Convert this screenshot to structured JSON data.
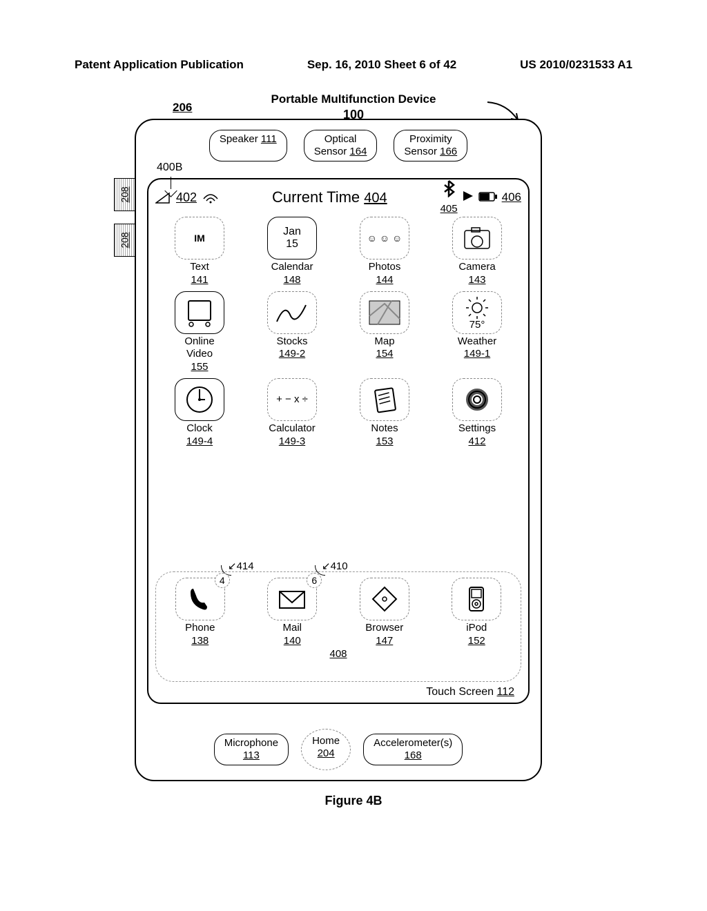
{
  "header": {
    "left": "Patent Application Publication",
    "center": "Sep. 16, 2010  Sheet 6 of 42",
    "right": "US 2010/0231533 A1"
  },
  "title": {
    "main": "Portable Multifunction Device",
    "ref206": "206",
    "ref100": "100"
  },
  "sideTab": "208",
  "ref400B": "400B",
  "sensors": {
    "speaker": {
      "label": "Speaker ",
      "ref": "111"
    },
    "optical": {
      "line1": "Optical",
      "line2": "Sensor ",
      "ref": "164"
    },
    "proximity": {
      "line1": "Proximity",
      "line2": "Sensor ",
      "ref": "166"
    }
  },
  "statusBar": {
    "sigRef": "402",
    "timeLabel": "Current Time ",
    "timeRef": "404",
    "btRef": "405",
    "battRef": "406"
  },
  "apps": [
    {
      "iconText": "IM",
      "label": "Text",
      "ref": "141",
      "type": "im"
    },
    {
      "iconText": "Jan\n15",
      "label": "Calendar",
      "ref": "148",
      "type": "cal",
      "solid": true
    },
    {
      "iconText": "☺ ☺ ☺",
      "label": "Photos",
      "ref": "144",
      "type": "photos"
    },
    {
      "iconText": "",
      "label": "Camera",
      "ref": "143",
      "type": "camera"
    },
    {
      "iconText": "",
      "label": "Online\nVideo",
      "ref": "155",
      "type": "video",
      "solid": true
    },
    {
      "iconText": "",
      "label": "Stocks",
      "ref": "149-2",
      "type": "stocks"
    },
    {
      "iconText": "",
      "label": "Map",
      "ref": "154",
      "type": "map"
    },
    {
      "iconText": "75°",
      "label": "Weather",
      "ref": "149-1",
      "type": "weather"
    },
    {
      "iconText": "",
      "label": "Clock",
      "ref": "149-4",
      "type": "clock",
      "solid": true
    },
    {
      "iconText": "+ − x ÷",
      "label": "Calculator",
      "ref": "149-3",
      "type": "calc"
    },
    {
      "iconText": "",
      "label": "Notes",
      "ref": "153",
      "type": "notes"
    },
    {
      "iconText": "",
      "label": "Settings",
      "ref": "412",
      "type": "settings"
    }
  ],
  "tray": {
    "ref414": "414",
    "ref410": "410",
    "ref408": "408",
    "items": [
      {
        "label": "Phone",
        "ref": "138",
        "badge": "4",
        "type": "phone"
      },
      {
        "label": "Mail",
        "ref": "140",
        "badge": "6",
        "type": "mail"
      },
      {
        "label": "Browser",
        "ref": "147",
        "type": "browser"
      },
      {
        "label": "iPod",
        "ref": "152",
        "type": "ipod",
        "solid": true
      }
    ]
  },
  "touchScreen": {
    "label": "Touch Screen ",
    "ref": "112"
  },
  "bottom": {
    "mic": {
      "label": "Microphone",
      "ref": "113"
    },
    "home": {
      "label": "Home",
      "ref": "204"
    },
    "accel": {
      "label": "Accelerometer(s)",
      "ref": "168"
    }
  },
  "figureCaption": "Figure 4B"
}
